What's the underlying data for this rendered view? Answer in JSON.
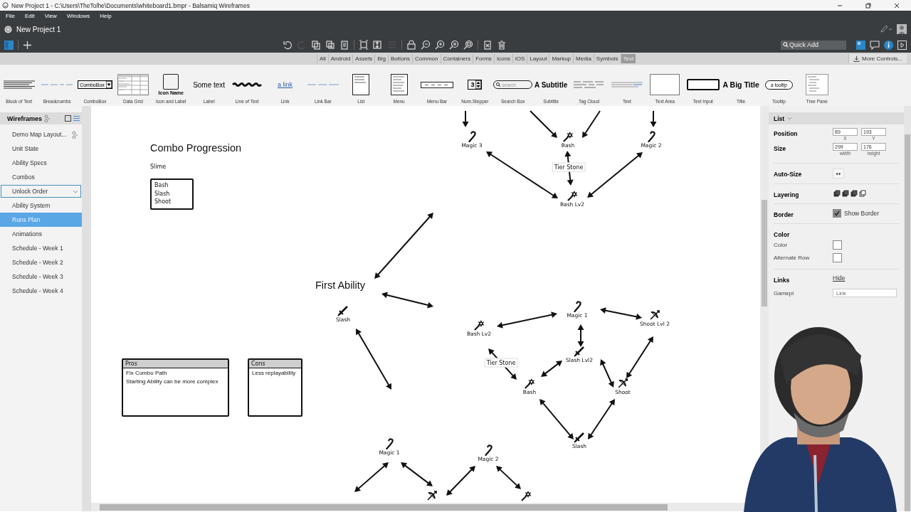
{
  "window": {
    "title": "New Project 1 - C:\\Users\\TheTolhe\\Documents\\whiteboard1.bmpr - Balsamiq Wireframes"
  },
  "menu": [
    "File",
    "Edit",
    "View",
    "Windows",
    "Help"
  ],
  "project": {
    "name": "New Project 1"
  },
  "quick_add": {
    "placeholder": "Quick Add"
  },
  "categories": [
    {
      "label": "All",
      "selected": false
    },
    {
      "label": "Android",
      "selected": false
    },
    {
      "label": "Assets",
      "selected": false
    },
    {
      "label": "Big",
      "selected": false
    },
    {
      "label": "Buttons",
      "selected": false
    },
    {
      "label": "Common",
      "selected": false
    },
    {
      "label": "Containers",
      "selected": false
    },
    {
      "label": "Forms",
      "selected": false
    },
    {
      "label": "Icons",
      "selected": false
    },
    {
      "label": "iOS",
      "selected": false
    },
    {
      "label": "Layout",
      "selected": false
    },
    {
      "label": "Markup",
      "selected": false
    },
    {
      "label": "Media",
      "selected": false
    },
    {
      "label": "Symbols",
      "selected": false
    },
    {
      "label": "Text",
      "selected": true
    }
  ],
  "more_controls": "More Controls...",
  "components": [
    {
      "kind": "block_text",
      "label": "Block of Text"
    },
    {
      "kind": "breadcrumbs",
      "label": "Breadcrumbs"
    },
    {
      "kind": "combobox",
      "label": "ComboBox",
      "preview": "ComboBox"
    },
    {
      "kind": "data_grid",
      "label": "Data Grid"
    },
    {
      "kind": "icon_label",
      "label": "Icon and Label",
      "preview": "Icon Name"
    },
    {
      "kind": "label",
      "label": "Label",
      "preview": "Some text"
    },
    {
      "kind": "line_of_text",
      "label": "Line of Text"
    },
    {
      "kind": "link",
      "label": "Link",
      "preview": "a link"
    },
    {
      "kind": "link_bar",
      "label": "Link Bar"
    },
    {
      "kind": "list",
      "label": "List"
    },
    {
      "kind": "menu",
      "label": "Menu"
    },
    {
      "kind": "menu_bar",
      "label": "Menu Bar"
    },
    {
      "kind": "num_stepper",
      "label": "Num.Stepper",
      "preview": "3"
    },
    {
      "kind": "search_box",
      "label": "Search Box",
      "preview": "search"
    },
    {
      "kind": "subtitle",
      "label": "Subtitle",
      "preview": "A Subtitle"
    },
    {
      "kind": "tag_cloud",
      "label": "Tag Cloud"
    },
    {
      "kind": "text",
      "label": "Text"
    },
    {
      "kind": "text_area",
      "label": "Text Area"
    },
    {
      "kind": "text_input",
      "label": "Text Input"
    },
    {
      "kind": "title",
      "label": "Title",
      "preview": "A Big Title"
    },
    {
      "kind": "tooltip",
      "label": "Tooltip",
      "preview": "a tooltip"
    },
    {
      "kind": "tree_pane",
      "label": "Tree Pane"
    }
  ],
  "sidebar": {
    "title": "Wireframes",
    "items": [
      {
        "label": "Demo Map Layout...",
        "selected": false,
        "focused": false,
        "linked": true
      },
      {
        "label": "Unit State",
        "selected": false,
        "focused": false,
        "linked": false
      },
      {
        "label": "Ability Specs",
        "selected": false,
        "focused": false,
        "linked": false
      },
      {
        "label": "Combos",
        "selected": false,
        "focused": false,
        "linked": false
      },
      {
        "label": "Unlock Order",
        "selected": false,
        "focused": true,
        "linked": false
      },
      {
        "label": "Ability System",
        "selected": false,
        "focused": false,
        "linked": false
      },
      {
        "label": "Runs Plan",
        "selected": true,
        "focused": false,
        "linked": false
      },
      {
        "label": "Animations",
        "selected": false,
        "focused": false,
        "linked": false
      },
      {
        "label": "Schedule - Week 1",
        "selected": false,
        "focused": false,
        "linked": false
      },
      {
        "label": "Schedule - Week 2",
        "selected": false,
        "focused": false,
        "linked": false
      },
      {
        "label": "Schedule - Week 3",
        "selected": false,
        "focused": false,
        "linked": false
      },
      {
        "label": "Schedule - Week 4",
        "selected": false,
        "focused": false,
        "linked": false
      }
    ]
  },
  "canvas": {
    "title": "Combo Progression",
    "subtitle": "Slime",
    "list": [
      "Bash",
      "Slash",
      "Shoot"
    ],
    "heading": "First Ability",
    "nodes": [
      {
        "kind": "magic",
        "label": "Magic 3"
      },
      {
        "kind": "bash",
        "label": "Bash"
      },
      {
        "kind": "magic",
        "label": "Magic 2"
      },
      {
        "kind": "bash",
        "label": "Bash Lv2"
      },
      {
        "kind": "slash",
        "label": "Slash"
      },
      {
        "kind": "magic",
        "label": "Magic 1"
      },
      {
        "kind": "bash",
        "label": "Bash Lv2"
      },
      {
        "kind": "shoot",
        "label": "Shoot Lvl 2"
      },
      {
        "kind": "slash",
        "label": "Slash Lvl2"
      },
      {
        "kind": "bash",
        "label": "Bash"
      },
      {
        "kind": "shoot",
        "label": "Shoot"
      },
      {
        "kind": "slash",
        "label": "Slash"
      },
      {
        "kind": "magic",
        "label": "Magic 1"
      },
      {
        "kind": "magic",
        "label": "Magic 2"
      },
      {
        "kind": "shoot"
      },
      {
        "kind": "bash"
      }
    ],
    "tags": [
      "Tier Stone",
      "Tier Stone"
    ],
    "tables": [
      {
        "header": "Pros",
        "rows": [
          "Fix Combo Path",
          "Starting Ability can be more complex"
        ]
      },
      {
        "header": "Cons",
        "rows": [
          "Less replayability"
        ]
      }
    ]
  },
  "properties": {
    "title": "List",
    "position": {
      "label": "Position",
      "fields": [
        {
          "value": "89",
          "caption": "X"
        },
        {
          "value": "193",
          "caption": "Y"
        }
      ]
    },
    "size": {
      "label": "Size",
      "fields": [
        {
          "value": "299",
          "caption": "width"
        },
        {
          "value": "176",
          "caption": "height"
        }
      ]
    },
    "auto_size": {
      "label": "Auto-Size",
      "button": "↔"
    },
    "layering": {
      "label": "Layering"
    },
    "border": {
      "label": "Border",
      "checkbox": "Show Border",
      "checked": true
    },
    "color": {
      "label": "Color",
      "swatches": [
        {
          "label": "Color",
          "color": "#ffffff"
        },
        {
          "label": "Alternate Row",
          "color": "#ffffff"
        }
      ]
    },
    "links": {
      "label": "Links",
      "toggle": "Hide",
      "rows": [
        {
          "label": "Gamepl",
          "value": "Link"
        }
      ]
    }
  }
}
